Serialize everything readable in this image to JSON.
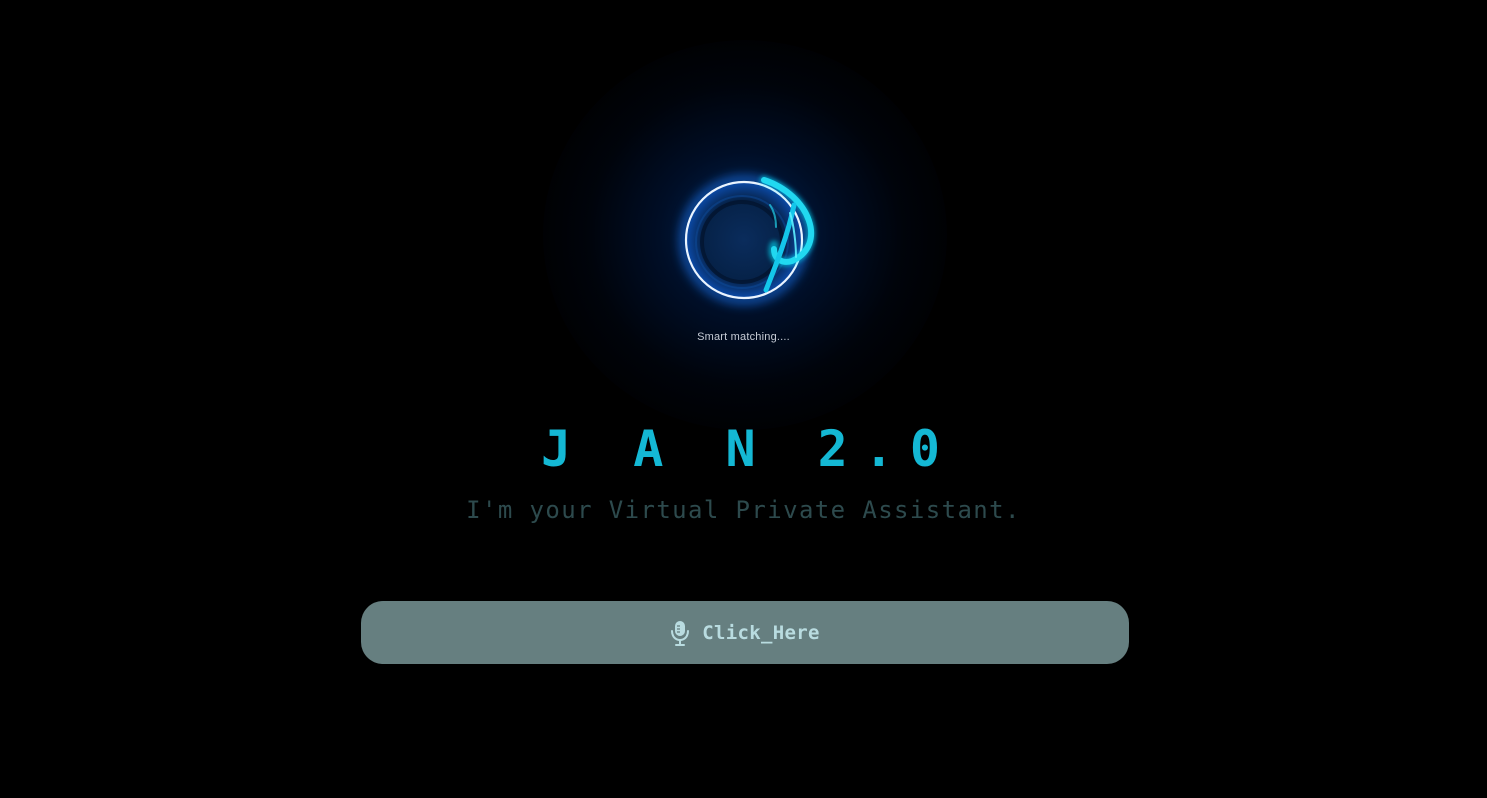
{
  "status": {
    "text": "Smart matching...."
  },
  "hero": {
    "title": "J A N 2.0",
    "subtitle": "I'm your Virtual Private Assistant."
  },
  "action": {
    "label": "Click_Here",
    "icon": "microphone-icon"
  },
  "colors": {
    "accent": "#14b8d4",
    "subtitle": "#2d4a4d",
    "button_bg": "#667f80",
    "button_text": "#b9dce0",
    "background": "#000000"
  }
}
